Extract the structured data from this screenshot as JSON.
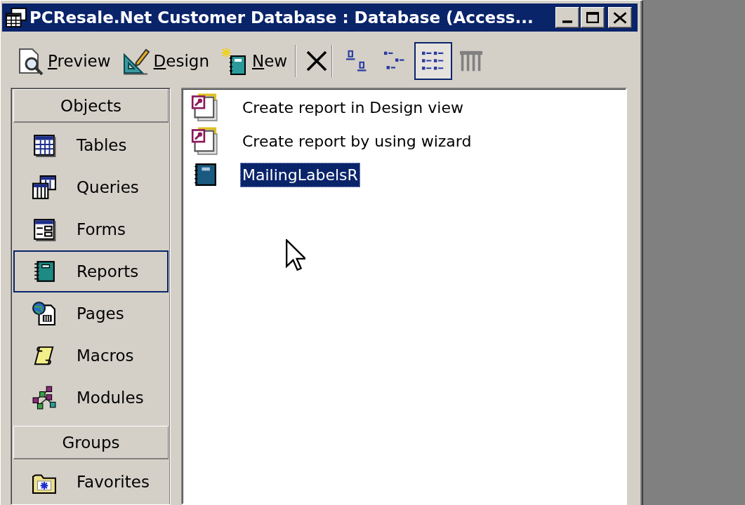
{
  "window": {
    "title": "PCResale.Net Customer Database : Database (Access...",
    "controls": [
      {
        "kind": "minimize"
      },
      {
        "kind": "maximize"
      },
      {
        "kind": "close"
      }
    ]
  },
  "toolbar": {
    "actions": [
      {
        "kind": "preview",
        "label": "Preview"
      },
      {
        "kind": "design",
        "label": "Design"
      },
      {
        "kind": "new",
        "label": "New"
      }
    ],
    "edit": [
      {
        "kind": "delete"
      }
    ],
    "views": [
      {
        "kind": "large",
        "selected": false
      },
      {
        "kind": "small",
        "selected": false
      },
      {
        "kind": "list",
        "selected": true
      },
      {
        "kind": "details",
        "selected": false
      }
    ]
  },
  "objects_bar": {
    "groups": [
      {
        "header": "Objects",
        "items": [
          {
            "kind": "tables",
            "label": "Tables",
            "selected": false
          },
          {
            "kind": "queries",
            "label": "Queries",
            "selected": false
          },
          {
            "kind": "forms",
            "label": "Forms",
            "selected": false
          },
          {
            "kind": "reports",
            "label": "Reports",
            "selected": true
          },
          {
            "kind": "pages",
            "label": "Pages",
            "selected": false
          },
          {
            "kind": "macros",
            "label": "Macros",
            "selected": false
          },
          {
            "kind": "modules",
            "label": "Modules",
            "selected": false
          }
        ]
      },
      {
        "header": "Groups",
        "items": [
          {
            "kind": "favorites",
            "label": "Favorites",
            "selected": false
          }
        ]
      }
    ]
  },
  "object_list": {
    "items": [
      {
        "kind": "shortcut",
        "label": "Create report in Design view",
        "selected": false
      },
      {
        "kind": "shortcut",
        "label": "Create report by using wizard",
        "selected": false
      },
      {
        "kind": "report",
        "label": "MailingLabelsR",
        "selected": true
      }
    ]
  }
}
